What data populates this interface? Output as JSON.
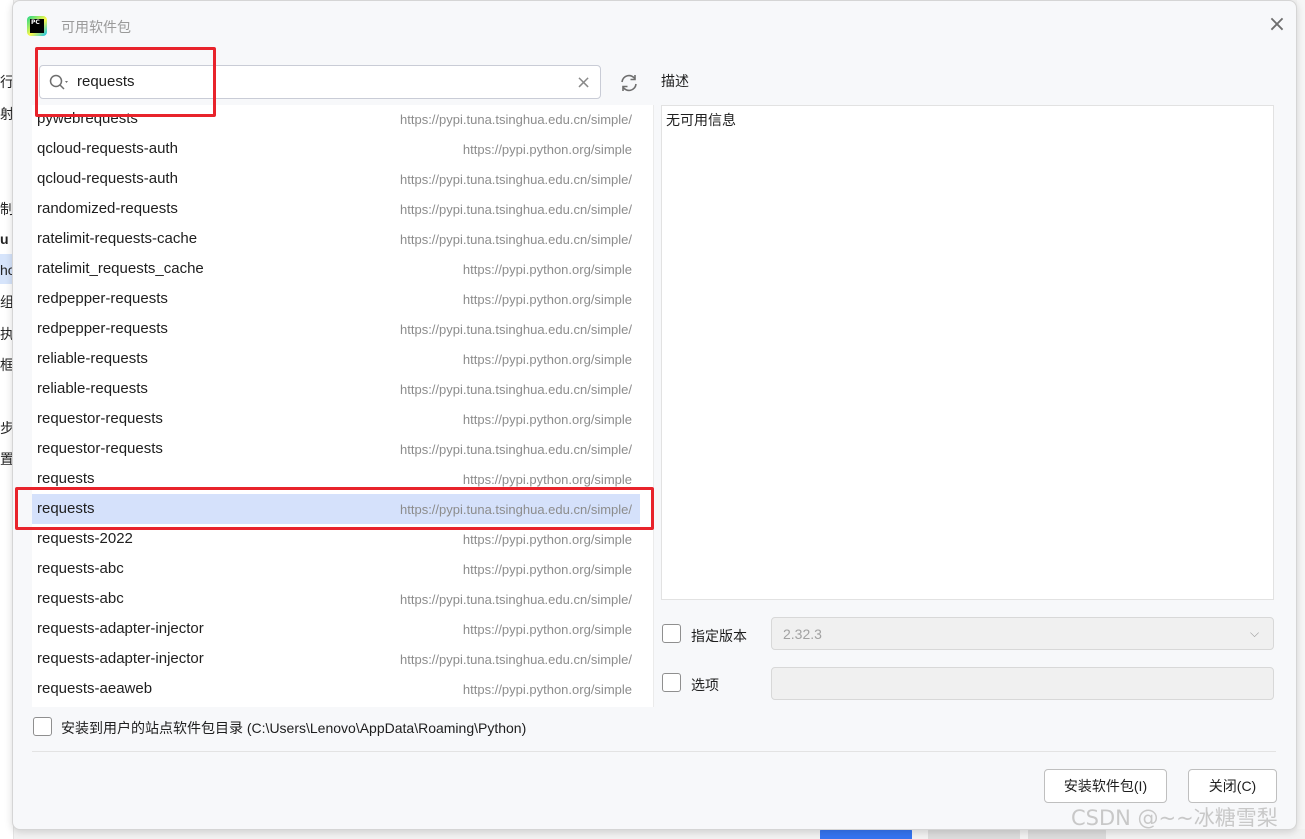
{
  "dialog": {
    "title": "可用软件包",
    "app_icon_text": "PC"
  },
  "search": {
    "value": "requests"
  },
  "packages": [
    {
      "name": "pywebrequests",
      "repo": "https://pypi.tuna.tsinghua.edu.cn/simple/"
    },
    {
      "name": "qcloud-requests-auth",
      "repo": "https://pypi.python.org/simple"
    },
    {
      "name": "qcloud-requests-auth",
      "repo": "https://pypi.tuna.tsinghua.edu.cn/simple/"
    },
    {
      "name": "randomized-requests",
      "repo": "https://pypi.tuna.tsinghua.edu.cn/simple/"
    },
    {
      "name": "ratelimit-requests-cache",
      "repo": "https://pypi.tuna.tsinghua.edu.cn/simple/"
    },
    {
      "name": "ratelimit_requests_cache",
      "repo": "https://pypi.python.org/simple"
    },
    {
      "name": "redpepper-requests",
      "repo": "https://pypi.python.org/simple"
    },
    {
      "name": "redpepper-requests",
      "repo": "https://pypi.tuna.tsinghua.edu.cn/simple/"
    },
    {
      "name": "reliable-requests",
      "repo": "https://pypi.python.org/simple"
    },
    {
      "name": "reliable-requests",
      "repo": "https://pypi.tuna.tsinghua.edu.cn/simple/"
    },
    {
      "name": "requestor-requests",
      "repo": "https://pypi.python.org/simple"
    },
    {
      "name": "requestor-requests",
      "repo": "https://pypi.tuna.tsinghua.edu.cn/simple/"
    },
    {
      "name": "requests",
      "repo": "https://pypi.python.org/simple"
    },
    {
      "name": "requests",
      "repo": "https://pypi.tuna.tsinghua.edu.cn/simple/",
      "selected": true
    },
    {
      "name": "requests-2022",
      "repo": "https://pypi.python.org/simple"
    },
    {
      "name": "requests-abc",
      "repo": "https://pypi.python.org/simple"
    },
    {
      "name": "requests-abc",
      "repo": "https://pypi.tuna.tsinghua.edu.cn/simple/"
    },
    {
      "name": "requests-adapter-injector",
      "repo": "https://pypi.python.org/simple"
    },
    {
      "name": "requests-adapter-injector",
      "repo": "https://pypi.tuna.tsinghua.edu.cn/simple/"
    },
    {
      "name": "requests-aeaweb",
      "repo": "https://pypi.python.org/simple"
    }
  ],
  "description": {
    "label": "描述",
    "text": "无可用信息"
  },
  "options": {
    "specify_version_label": "指定版本",
    "version_value": "2.32.3",
    "options_label": "选项",
    "options_value": "",
    "install_to_user_label": "安装到用户的站点软件包目录 (C:\\Users\\Lenovo\\AppData\\Roaming\\Python)"
  },
  "buttons": {
    "install": "安装软件包(I)",
    "close": "关闭(C)"
  },
  "background_window": {
    "side_chars": [
      "行",
      "射",
      "制",
      "u",
      "ho",
      "组",
      "执",
      "框",
      "步",
      "置"
    ]
  },
  "watermark": "CSDN @~~冰糖雪梨",
  "colors": {
    "accent_blue": "#3574f0",
    "selected_row": "#d5e1fb",
    "highlight_red": "#e8232b"
  }
}
